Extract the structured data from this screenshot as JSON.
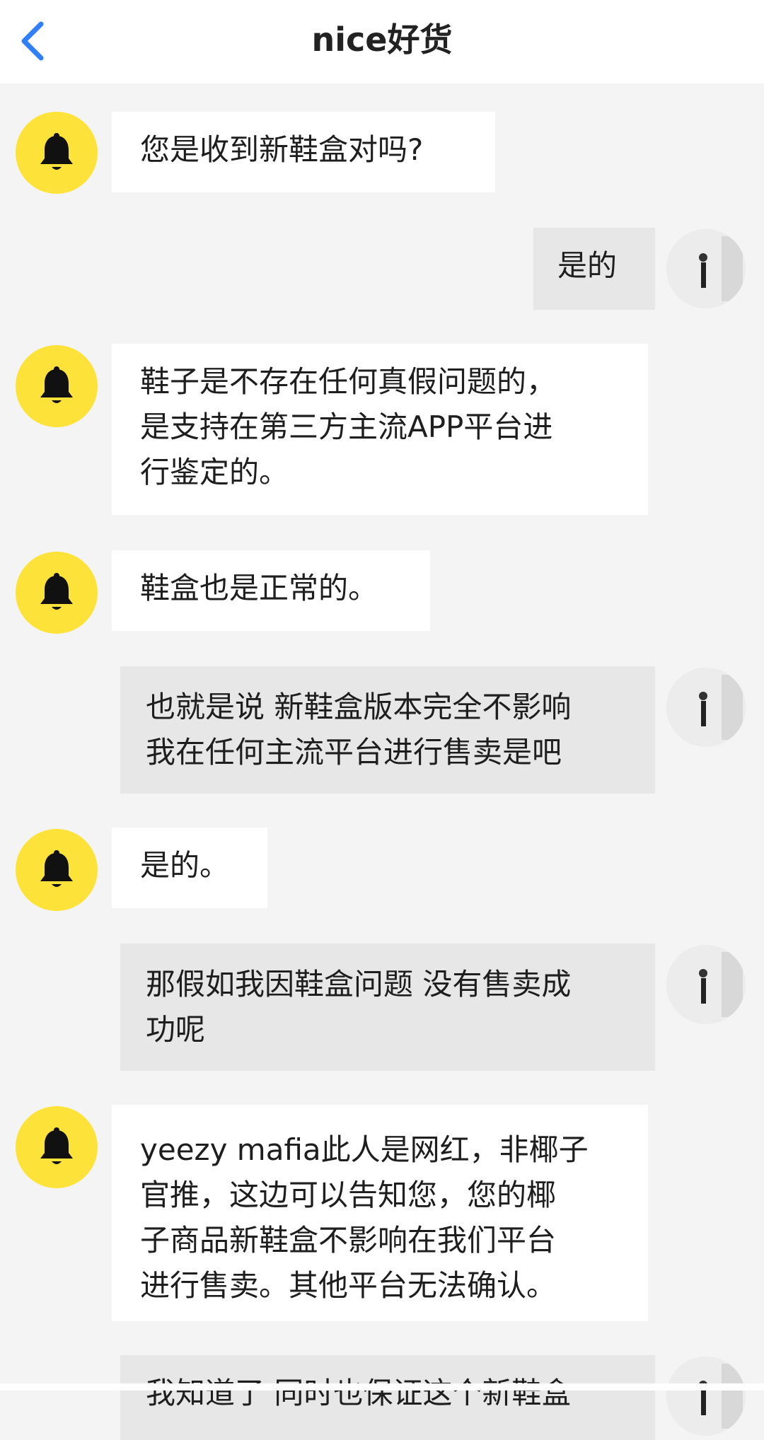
{
  "header": {
    "title": "nice好货",
    "back_icon": "chevron-left-icon",
    "accent_color": "#2f7ff7"
  },
  "colors": {
    "bot_avatar": "#fde23a",
    "bot_bubble": "#ffffff",
    "user_bubble": "#e7e7e7",
    "background": "#f4f4f4"
  },
  "messages": [
    {
      "from": "bot",
      "text": "您是收到新鞋盒对吗?"
    },
    {
      "from": "user",
      "text": "是的"
    },
    {
      "from": "bot",
      "text": "鞋子是不存在任何真假问题的，\n是支持在第三方主流APP平台进\n行鉴定的。"
    },
    {
      "from": "bot",
      "text": "鞋盒也是正常的。"
    },
    {
      "from": "user",
      "text": "也就是说 新鞋盒版本完全不影响\n我在任何主流平台进行售卖是吧"
    },
    {
      "from": "bot",
      "text": "是的。"
    },
    {
      "from": "user",
      "text": "那假如我因鞋盒问题 没有售卖成\n功呢"
    },
    {
      "from": "bot",
      "text": "yeezy mafia此人是网红，非椰子\n官推，这边可以告知您，您的椰\n子商品新鞋盒不影响在我们平台\n进行售卖。其他平台无法确认。"
    },
    {
      "from": "user",
      "text": "我知道了 同时也保证这个新鞋盒"
    }
  ]
}
